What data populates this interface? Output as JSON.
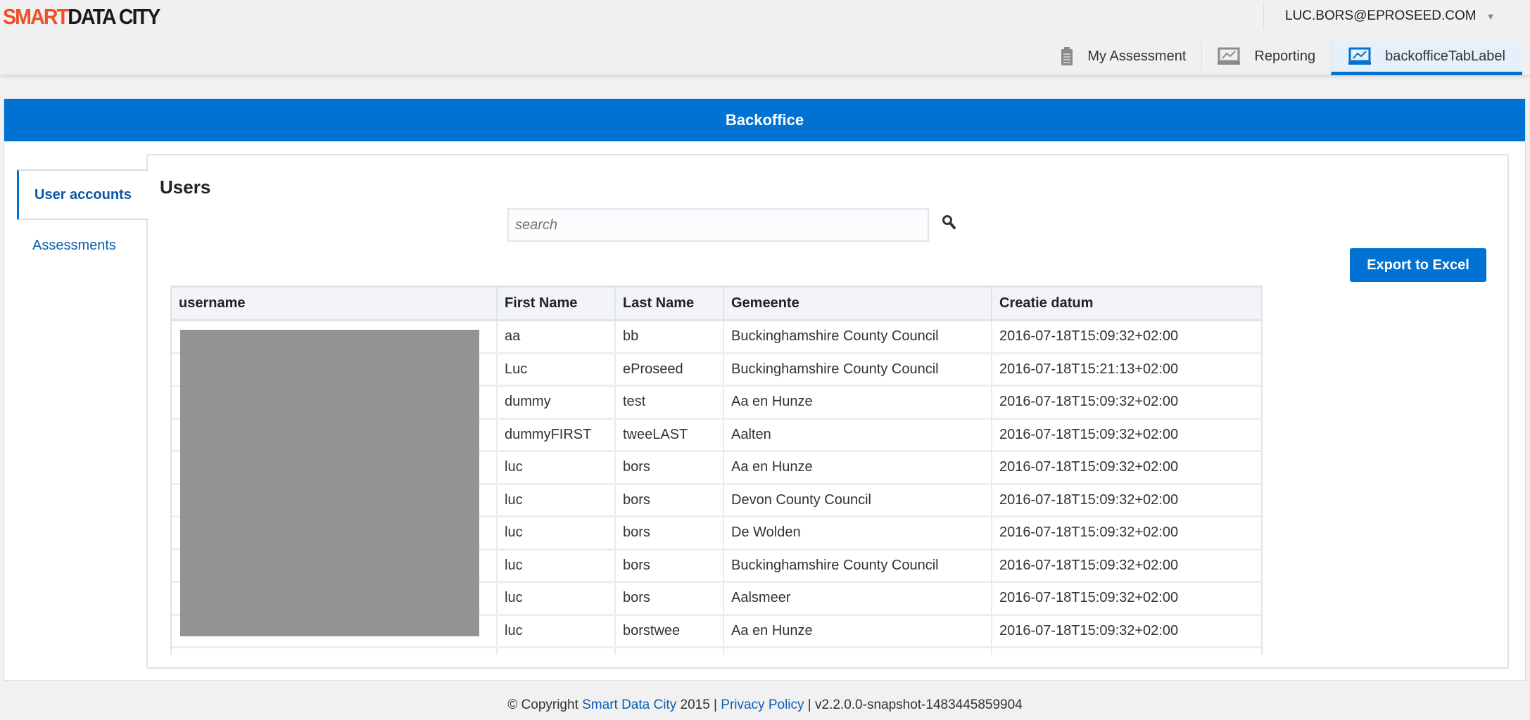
{
  "header": {
    "logo_part1": "SMART",
    "logo_part2": "DATA CITY",
    "user_email": "LUC.BORS@EPROSEED.COM",
    "tabs": [
      {
        "label": "My Assessment",
        "icon": "clipboard-icon"
      },
      {
        "label": "Reporting",
        "icon": "chart-monitor-icon"
      },
      {
        "label": "backofficeTabLabel",
        "icon": "chart-monitor-icon",
        "active": true
      }
    ]
  },
  "banner": {
    "title": "Backoffice"
  },
  "sidebar": {
    "items": [
      {
        "label": "User accounts",
        "active": true
      },
      {
        "label": "Assessments"
      }
    ]
  },
  "users": {
    "title": "Users",
    "search_placeholder": "search",
    "export_label": "Export to Excel",
    "columns": [
      "username",
      "First Name",
      "Last Name",
      "Gemeente",
      "Creatie datum"
    ],
    "rows": [
      [
        "",
        "aa",
        "bb",
        "Buckinghamshire County Council",
        "2016-07-18T15:09:32+02:00"
      ],
      [
        "",
        "Luc",
        "eProseed",
        "Buckinghamshire County Council",
        "2016-07-18T15:21:13+02:00"
      ],
      [
        "",
        "dummy",
        "test",
        "Aa en Hunze",
        "2016-07-18T15:09:32+02:00"
      ],
      [
        "",
        "dummyFIRST",
        "tweeLAST",
        "Aalten",
        "2016-07-18T15:09:32+02:00"
      ],
      [
        "",
        "luc",
        "bors",
        "Aa en Hunze",
        "2016-07-18T15:09:32+02:00"
      ],
      [
        "",
        "luc",
        "bors",
        "Devon County Council",
        "2016-07-18T15:09:32+02:00"
      ],
      [
        "",
        "luc",
        "bors",
        "De Wolden",
        "2016-07-18T15:09:32+02:00"
      ],
      [
        "",
        "luc",
        "bors",
        "Buckinghamshire County Council",
        "2016-07-18T15:09:32+02:00"
      ],
      [
        "",
        "luc",
        "bors",
        "Aalsmeer",
        "2016-07-18T15:09:32+02:00"
      ],
      [
        "",
        "luc",
        "borstwee",
        "Aa en Hunze",
        "2016-07-18T15:09:32+02:00"
      ],
      [
        "",
        "",
        "",
        "",
        ""
      ]
    ]
  },
  "footer": {
    "copyright": "© Copyright ",
    "brand_link": "Smart Data City",
    "year": " 2015 | ",
    "privacy_link": "Privacy Policy",
    "version": " | v2.2.0.0-snapshot-1483445859904"
  }
}
